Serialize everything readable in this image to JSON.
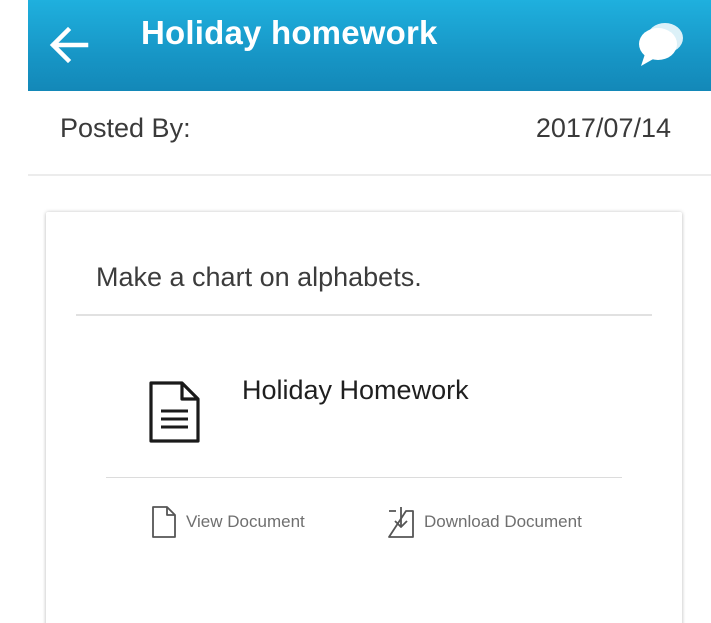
{
  "appbar": {
    "title": "Holiday homework",
    "back_icon": "arrow-left-icon",
    "chat_icon": "chat-bubbles-icon",
    "color": "#1796c6"
  },
  "post": {
    "posted_by_label": "Posted By:",
    "date": "2017/07/14"
  },
  "card": {
    "description": "Make a chart on alphabets.",
    "attachment": {
      "title": "Holiday Homework",
      "icon": "document-icon",
      "view_label": "View Document",
      "view_icon": "file-icon",
      "download_label": "Download Document",
      "download_icon": "download-icon"
    }
  }
}
